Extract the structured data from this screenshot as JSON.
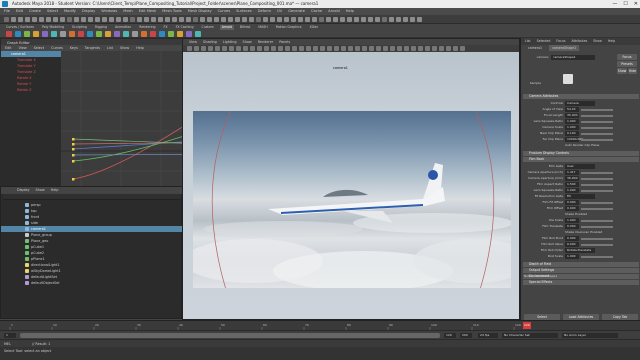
{
  "titlebar": {
    "text": "Autodesk Maya 2018 - Student Version: C:\\Users\\Client_Temp\\Plane_Compositing_Tutorial\\Project_Folder\\scenes\\Plane_Compositing_001.ma* — camera1"
  },
  "menubar": [
    "File",
    "Edit",
    "Create",
    "Select",
    "Modify",
    "Display",
    "Windows",
    "Mesh",
    "Edit Mesh",
    "Mesh Tools",
    "Mesh Display",
    "Curves",
    "Surfaces",
    "Deform",
    "UV",
    "Generate",
    "Cache",
    "Arnold",
    "Help"
  ],
  "shelf": {
    "tabs": [
      "Curves / Surfaces",
      "Poly Modeling",
      "Sculpting",
      "Rigging",
      "Animation",
      "Rendering",
      "FX",
      "FX Caching",
      "Custom",
      "Arnold",
      "Bifrost",
      "MASH",
      "Motion Graphics",
      "XGen"
    ],
    "active_tab": "Arnold"
  },
  "graph_editor": {
    "title": "Graph Editor",
    "menu": [
      "Edit",
      "View",
      "Select",
      "Curves",
      "Keys",
      "Tangents",
      "List",
      "Show",
      "Help"
    ],
    "outliner_rows": [
      "camera1",
      "Translate X",
      "Translate Y",
      "Translate Z",
      "Rotate X",
      "Rotate Y",
      "Rotate Z"
    ]
  },
  "outliner": {
    "menu": [
      "Display",
      "Show",
      "Help"
    ],
    "rows": [
      "persp",
      "top",
      "front",
      "side",
      "camera1",
      "Plane_group",
      "Plane_geo",
      "pCube1",
      "pCube2",
      "pPlane1",
      "directionalLight1",
      "aiSkyDomeLight1",
      "defaultLightSet",
      "defaultObjectSet"
    ],
    "selected": "camera1"
  },
  "viewport": {
    "menu": [
      "View",
      "Shading",
      "Lighting",
      "Show",
      "Renderer",
      "Panels"
    ],
    "camera_label": "camera1",
    "bottom_label": "camera1"
  },
  "attribute_editor": {
    "top_tabs": [
      "List",
      "Selected",
      "Focus",
      "Attributes",
      "Show",
      "Help"
    ],
    "node_tabs": [
      "camera1",
      "cameraShape1"
    ],
    "shape_label": "camera:",
    "shape_value": "cameraShape1",
    "focus_btn": "Focus",
    "presets_btn": "Presets",
    "show_btn": "Show",
    "hide_btn": "Hide",
    "sample_label": "Sample",
    "sections": {
      "camera_attributes": "Camera Attributes",
      "frustum": "Frustum Display Controls",
      "film_back": "Film Back",
      "depth_of_field": "Depth of Field",
      "output_settings": "Output Settings",
      "environment": "Environment",
      "special_effects": "Special Effects"
    },
    "camera_fields": [
      {
        "label": "Controls",
        "value": "Camera"
      },
      {
        "label": "Angle of View",
        "value": "54.43"
      },
      {
        "label": "Focal Length",
        "value": "35.000"
      },
      {
        "label": "Lens Squeeze Ratio",
        "value": "1.000"
      },
      {
        "label": "Camera Scale",
        "value": "1.000"
      },
      {
        "label": "Near Clip Plane",
        "value": "0.100"
      },
      {
        "label": "Far Clip Plane",
        "value": "10000.000"
      }
    ],
    "auto_render_clip": "Auto Render Clip Plane",
    "film_fields": [
      {
        "label": "Film Gate",
        "value": "User"
      },
      {
        "label": "Camera Aperture (inch)",
        "value": "1.417"
      },
      {
        "label": "Camera Aperture (mm)",
        "value": "36.000"
      },
      {
        "label": "Film Aspect Ratio",
        "value": "1.500"
      },
      {
        "label": "Lens Squeeze Ratio",
        "value": "1.000"
      },
      {
        "label": "Fit Resolution Gate",
        "value": "Fill"
      },
      {
        "label": "Film Fit Offset",
        "value": "0.000"
      },
      {
        "label": "Film Offset",
        "value": "0.000"
      },
      {
        "label": "Pre Scale",
        "value": "1.000"
      },
      {
        "label": "Film Translate",
        "value": "0.000"
      },
      {
        "label": "Film Roll Pivot",
        "value": "0.000"
      },
      {
        "label": "Film Roll Value",
        "value": "0.000"
      },
      {
        "label": "Film Roll Order",
        "value": "Rotate-Translate"
      },
      {
        "label": "Post Scale",
        "value": "1.000"
      }
    ],
    "shake_enabled": "Shake Enabled",
    "shake_overscan": "Shake Overscan Enabled",
    "notes_label": "Notes: cameraShape1",
    "buttons": {
      "select": "Select",
      "load": "Load Attributes",
      "copy": "Copy Tab"
    }
  },
  "timeline": {
    "ticks": [
      "1",
      "10",
      "20",
      "30",
      "40",
      "50",
      "60",
      "70",
      "80",
      "90",
      "100",
      "110",
      "120"
    ],
    "current_frame": "120",
    "range_start": "1",
    "range_end": "120",
    "anim_end": "200",
    "fps": "24 fps",
    "no_character": "No Character Set",
    "no_anim_layer": "No Anim Layer"
  },
  "command_line": {
    "lang": "MEL",
    "result": "// Result: 1"
  },
  "help_line": "Select Tool: select an object",
  "colors": {
    "selection": "#5285a6",
    "timeline_red": "#d73d3d",
    "time_marker": "#e6b62d",
    "maya_blue": "#1a7fb4"
  },
  "icons": [
    "maya-logo-icon",
    "minimize-icon",
    "maximize-icon",
    "close-icon",
    "camera-icon",
    "transform-icon",
    "play-icon"
  ]
}
